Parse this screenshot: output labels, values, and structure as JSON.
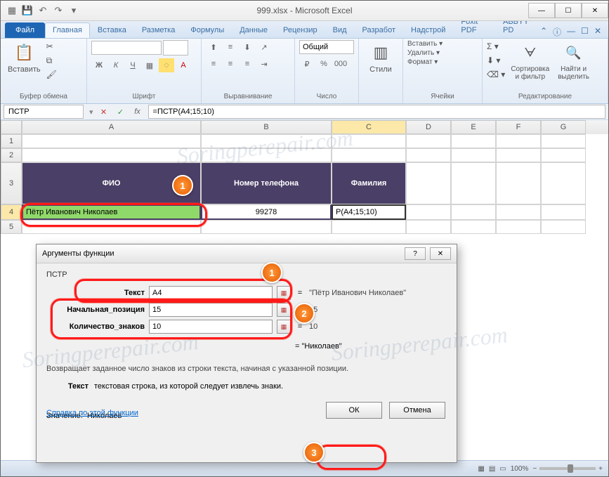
{
  "title": "999.xlsx - Microsoft Excel",
  "tabs": {
    "file": "Файл",
    "home": "Главная",
    "insert": "Вставка",
    "layout": "Разметка",
    "formulas": "Формулы",
    "data": "Данные",
    "review": "Рецензир",
    "view": "Вид",
    "dev": "Разработ",
    "addins": "Надстрой",
    "foxit": "Foxit PDF",
    "abbyy": "ABBYY PD"
  },
  "ribbon": {
    "clipboard": {
      "paste": "Вставить",
      "label": "Буфер обмена"
    },
    "font": {
      "label": "Шрифт"
    },
    "align": {
      "label": "Выравнивание"
    },
    "number": {
      "format": "Общий",
      "label": "Число"
    },
    "styles": {
      "btn": "Стили"
    },
    "cells": {
      "insert": "Вставить ▾",
      "delete": "Удалить ▾",
      "format": "Формат ▾",
      "label": "Ячейки"
    },
    "editing": {
      "sort": "Сортировка\nи фильтр",
      "find": "Найти и\nвыделить",
      "label": "Редактирование"
    }
  },
  "namebox": "ПСТР",
  "formula": "=ПСТР(A4;15;10)",
  "cols": {
    "A": "A",
    "B": "B",
    "C": "C",
    "D": "D",
    "E": "E",
    "F": "F",
    "G": "G"
  },
  "headers": {
    "fio": "ФИО",
    "phone": "Номер телефона",
    "surname": "Фамилия"
  },
  "data_row": {
    "a4": "Пётр Иванович Николаев",
    "b4": "99278",
    "c4": "Р(A4;15;10)"
  },
  "dialog": {
    "title": "Аргументы функции",
    "func": "ПСТР",
    "args": {
      "text": {
        "label": "Текст",
        "value": "A4",
        "result": "\"Пётр Иванович Николаев\""
      },
      "start": {
        "label": "Начальная_позиция",
        "value": "15",
        "result": "15"
      },
      "num": {
        "label": "Количество_знаков",
        "value": "10",
        "result": "10"
      }
    },
    "preview_eq": "=  \"Николаев\"",
    "desc": "Возвращает заданное число знаков из строки текста, начиная с указанной позиции.",
    "argdesc_label": "Текст",
    "argdesc": "текстовая строка, из которой следует извлечь знаки.",
    "result_label": "Значение:",
    "result": "Николаев",
    "help": "Справка по этой функции",
    "ok": "ОК",
    "cancel": "Отмена"
  },
  "callouts": {
    "1": "1",
    "2": "2",
    "3": "3"
  },
  "status": {
    "zoom": "100%"
  },
  "watermark": "Soringperepair.com"
}
